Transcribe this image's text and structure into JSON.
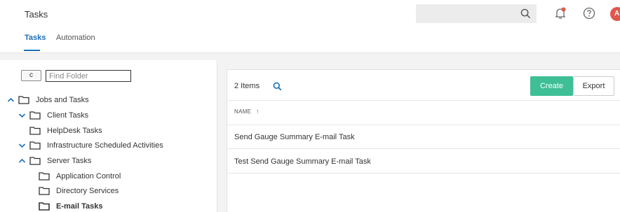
{
  "header": {
    "title": "Tasks",
    "avatar_initial": "A",
    "tabs": [
      {
        "label": "Tasks",
        "active": true
      },
      {
        "label": "Automation",
        "active": false
      }
    ]
  },
  "toolbar": {
    "refresh_glyph": "c",
    "find_placeholder": "Find Folder"
  },
  "tree": [
    {
      "label": "Jobs and Tasks",
      "expanded": true
    },
    {
      "label": "Client Tasks",
      "expanded": true
    },
    {
      "label": "HelpDesk Tasks"
    },
    {
      "label": "Infrastructure Scheduled Activities",
      "expanded": true
    },
    {
      "label": "Server Tasks",
      "expanded": true
    },
    {
      "label": "Application Control"
    },
    {
      "label": "Directory Services"
    },
    {
      "label": "E-mail Tasks",
      "selected": true
    }
  ],
  "list": {
    "count_label": "2 Items",
    "create_label": "Create",
    "export_label": "Export",
    "column_name": "NAME",
    "sort_glyph": "↑",
    "rows": [
      "Send Gauge Summary E-mail Task",
      "Test Send Gauge Summary E-mail Task"
    ]
  },
  "colors": {
    "accent": "#1d6fb8",
    "create": "#3ebf96",
    "avatar": "#e0574e",
    "bell_dot": "#e0574e"
  }
}
